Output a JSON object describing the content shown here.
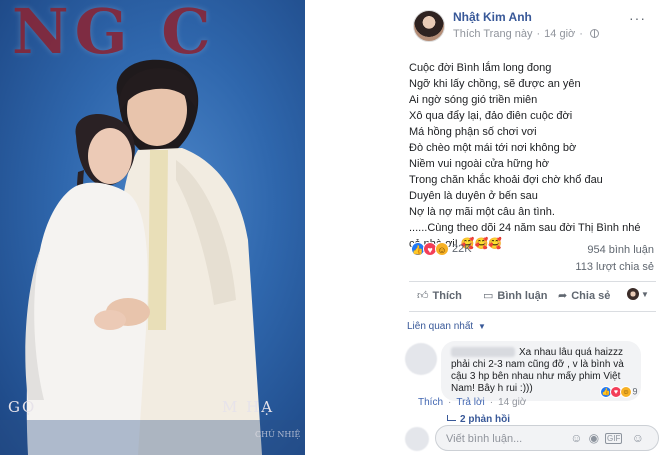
{
  "photo": {
    "banner_text": "NG C",
    "credit_left": "GỌ",
    "credit_right": "M HẠ",
    "credit_small": "CHỦ NHIỆ"
  },
  "post": {
    "author": "Nhật Kim Anh",
    "page_link": "Thích Trang này",
    "time": "14 giờ",
    "more": "···",
    "lines": [
      "Cuộc đời Bình lắm long đong",
      "Ngỡ khi lấy chồng, sẽ được an yên",
      "Ai ngờ sóng gió triền miên",
      "Xô qua đẩy lại, đảo điên cuộc đời",
      "Má hồng phận số chơi vơi",
      "Đò chèo một mái tới nơi không bờ",
      "Niềm vui ngoài cửa hững hờ",
      "Trong chăn khắc khoải đợi chờ khổ đau",
      "Duyên là duyên ở bến sau",
      "Nợ là nợ mãi một câu ân tình."
    ],
    "closing": "......Cùng theo dõi 24 năm sau đời Thị Bình nhé cả nhà ơi!",
    "closing_emoji": "🥰🥰🥰"
  },
  "stats": {
    "reaction_count": "22K",
    "comments": "954 bình luận",
    "shares": "113 lượt chia sẻ"
  },
  "actions": {
    "like": "Thích",
    "comment": "Bình luận",
    "share": "Chia sẻ"
  },
  "comments": {
    "sort_label": "Liên quan nhất",
    "first": {
      "text": "Xa nhau lâu quá haizzz phải chi 2-3 nam cũng đỡ , v là bình và cậu 3 hp bên nhau như mấy phim Việt Nam! Bây h rui :)))",
      "reaction_count": "9",
      "like_label": "Thích",
      "reply_label": "Trả lời",
      "time": "14 giờ"
    },
    "replies_label": "2 phản hồi",
    "composer_placeholder": "Viết bình luận..."
  }
}
